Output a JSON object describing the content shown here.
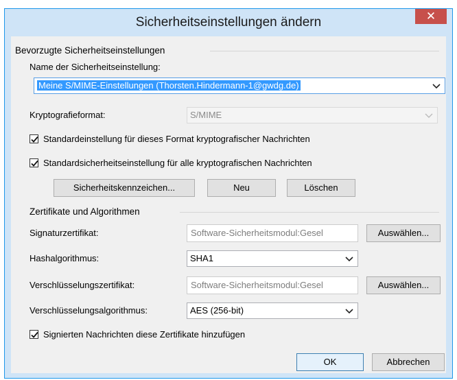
{
  "dialog": {
    "title": "Sicherheitseinstellungen ändern",
    "close_glyph": "✕"
  },
  "preferred": {
    "group_label": "Bevorzugte Sicherheitseinstellungen",
    "name_label": "Name der Sicherheitseinstellung:",
    "name_value": "Meine S/MIME-Einstellungen (Thorsten.Hindermann-1@gwdg.de)",
    "crypto_label": "Kryptografieformat:",
    "crypto_value": "S/MIME",
    "check_default_format": "Standardeinstellung für dieses Format kryptografischer Nachrichten",
    "check_default_all": "Standardsicherheitseinstellung für alle kryptografischen Nachrichten",
    "check_default_format_checked": true,
    "check_default_all_checked": true,
    "btn_labels": "Sicherheitskennzeichen...",
    "btn_new": "Neu",
    "btn_delete": "Löschen"
  },
  "certs": {
    "group_label": "Zertifikate und Algorithmen",
    "sign_label": "Signaturzertifikat:",
    "sign_value": "Software-Sicherheitsmodul:Gesel",
    "sign_choose": "Auswählen...",
    "hash_label": "Hashalgorithmus:",
    "hash_value": "SHA1",
    "enc_label": "Verschlüsselungszertifikat:",
    "enc_value": "Software-Sicherheitsmodul:Gesel",
    "enc_choose": "Auswählen...",
    "encalg_label": "Verschlüsselungsalgorithmus:",
    "encalg_value": "AES (256-bit)",
    "check_attach": "Signierten Nachrichten diese Zertifikate hinzufügen",
    "check_attach_checked": true
  },
  "footer": {
    "ok": "OK",
    "cancel": "Abbrechen"
  },
  "colors": {
    "titlebar": "#cfe4f7",
    "close": "#c7504b",
    "selection": "#3399ff"
  }
}
